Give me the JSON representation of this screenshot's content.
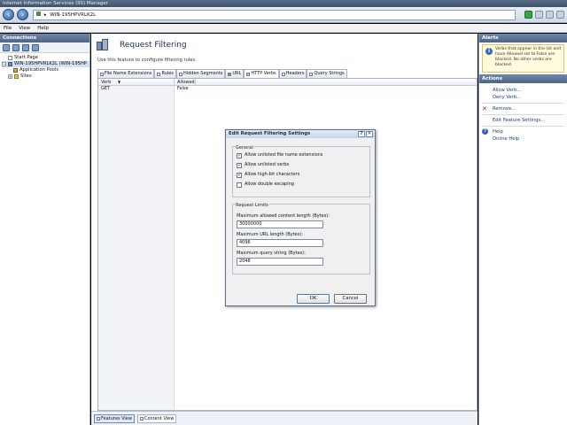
{
  "window": {
    "title": "Internet Information Services (IIS) Manager"
  },
  "address": {
    "path": "WIN-195HPVRLK2L",
    "separator": "▸"
  },
  "menu": {
    "items": [
      "File",
      "View",
      "Help"
    ]
  },
  "connections": {
    "title": "Connections",
    "tree": [
      {
        "label": "Start Page",
        "indent": 1,
        "icon": "start-page-icon"
      },
      {
        "label": "WIN-195HPVRLK2L (WIN-195HP",
        "indent": 0,
        "icon": "server-icon",
        "expander": "−",
        "selected": true
      },
      {
        "label": "Application Pools",
        "indent": 2,
        "icon": "app-pool-icon"
      },
      {
        "label": "Sites",
        "indent": 1,
        "icon": "folder-icon",
        "expander": "+"
      }
    ]
  },
  "feature": {
    "title": "Request Filtering",
    "description": "Use this feature to configure filtering rules.",
    "tabs": [
      {
        "label": "File Name Extensions",
        "active": false
      },
      {
        "label": "Rules",
        "active": false
      },
      {
        "label": "Hidden Segments",
        "active": false
      },
      {
        "label": "URL",
        "active": false
      },
      {
        "label": "HTTP Verbs",
        "active": true
      },
      {
        "label": "Headers",
        "active": false
      },
      {
        "label": "Query Strings",
        "active": false
      }
    ],
    "columns": [
      {
        "label": "Verb",
        "sort": "▼"
      },
      {
        "label": "Allowed"
      }
    ],
    "rows": [
      {
        "verb": "GET",
        "allowed": "False"
      }
    ],
    "views": [
      {
        "label": "Features View",
        "active": true
      },
      {
        "label": "Content View",
        "active": false
      }
    ]
  },
  "alerts": {
    "title": "Alerts",
    "message": "Verbs that appear in the list and have Allowed set to False are blocked. No other verbs are blocked."
  },
  "actions": {
    "title": "Actions",
    "allow_verb": "Allow Verb...",
    "deny_verb": "Deny Verb...",
    "remove": "Remove...",
    "edit_feature_settings": "Edit Feature Settings...",
    "help": "Help",
    "online_help": "Online Help"
  },
  "dialog": {
    "title": "Edit Request Filtering Settings",
    "help_btn": "?",
    "close_btn": "✕",
    "general": {
      "label": "General",
      "options": [
        {
          "label": "Allow unlisted file name extensions",
          "checked": true
        },
        {
          "label": "Allow unlisted verbs",
          "checked": true
        },
        {
          "label": "Allow high-bit characters",
          "checked": true
        },
        {
          "label": "Allow double escaping",
          "checked": false
        }
      ]
    },
    "limits": {
      "label": "Request Limits",
      "max_content_label": "Maximum allowed content length (Bytes):",
      "max_content_value": "30000000",
      "max_url_label": "Maximum URL length (Bytes):",
      "max_url_value": "4096",
      "max_query_label": "Maximum query string (Bytes):",
      "max_query_value": "2048"
    },
    "ok": "OK",
    "cancel": "Cancel"
  }
}
